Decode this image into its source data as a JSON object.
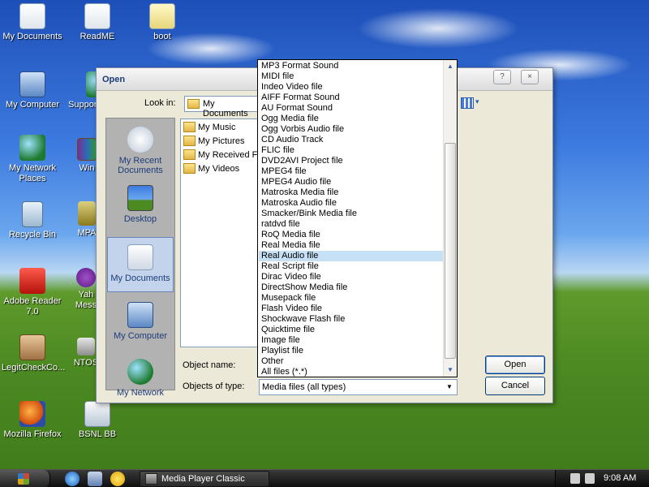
{
  "desktop": {
    "icons": [
      {
        "label": "My Documents"
      },
      {
        "label": "ReadME"
      },
      {
        "label": "boot"
      },
      {
        "label": "My Computer"
      },
      {
        "label": "Suppor"
      },
      {
        "label": "My Network Places"
      },
      {
        "label": "Win"
      },
      {
        "label": "Recycle Bin"
      },
      {
        "label": "MPA"
      },
      {
        "label": "Adobe Reader 7.0"
      },
      {
        "label": "Yah Mess"
      },
      {
        "label": "LegitCheckCo..."
      },
      {
        "label": "NTOS"
      },
      {
        "label": "Mozilla Firefox"
      },
      {
        "label": "BSNL BB"
      }
    ]
  },
  "dialog": {
    "title": "Open",
    "help_button": "?",
    "close_button": "×",
    "look_in_label": "Look in:",
    "look_in_value": "My Documents",
    "places": [
      {
        "label": "My Recent Documents"
      },
      {
        "label": "Desktop"
      },
      {
        "label": "My Documents"
      },
      {
        "label": "My Computer"
      },
      {
        "label": "My Network"
      }
    ],
    "files": [
      "My Music",
      "My Pictures",
      "My Received Fil",
      "My Videos"
    ],
    "object_name_label": "Object name:",
    "object_name_value": "",
    "objects_of_type_label": "Objects of type:",
    "objects_of_type_value": "Media files (all types)",
    "open_button": "Open",
    "cancel_button": "Cancel"
  },
  "dropdown": {
    "selected_index": 18,
    "items": [
      "MP3 Format Sound",
      "MIDI file",
      "Indeo Video file",
      "AIFF Format Sound",
      "AU Format Sound",
      "Ogg Media file",
      "Ogg Vorbis Audio file",
      "CD Audio Track",
      "FLIC file",
      "DVD2AVI Project file",
      "MPEG4 file",
      "MPEG4 Audio file",
      "Matroska Media file",
      "Matroska Audio file",
      "Smacker/Bink Media file",
      "ratdvd file",
      "RoQ Media file",
      "Real Media file",
      "Real Audio file",
      "Real Script file",
      "Dirac Video file",
      "DirectShow Media file",
      "Musepack file",
      "Flash Video file",
      "Shockwave Flash file",
      "Quicktime file",
      "Image file",
      "Playlist file",
      "Other",
      "All files (*.*)"
    ]
  },
  "taskbar": {
    "task_label": "Media Player Classic",
    "clock": "9:08 AM"
  }
}
